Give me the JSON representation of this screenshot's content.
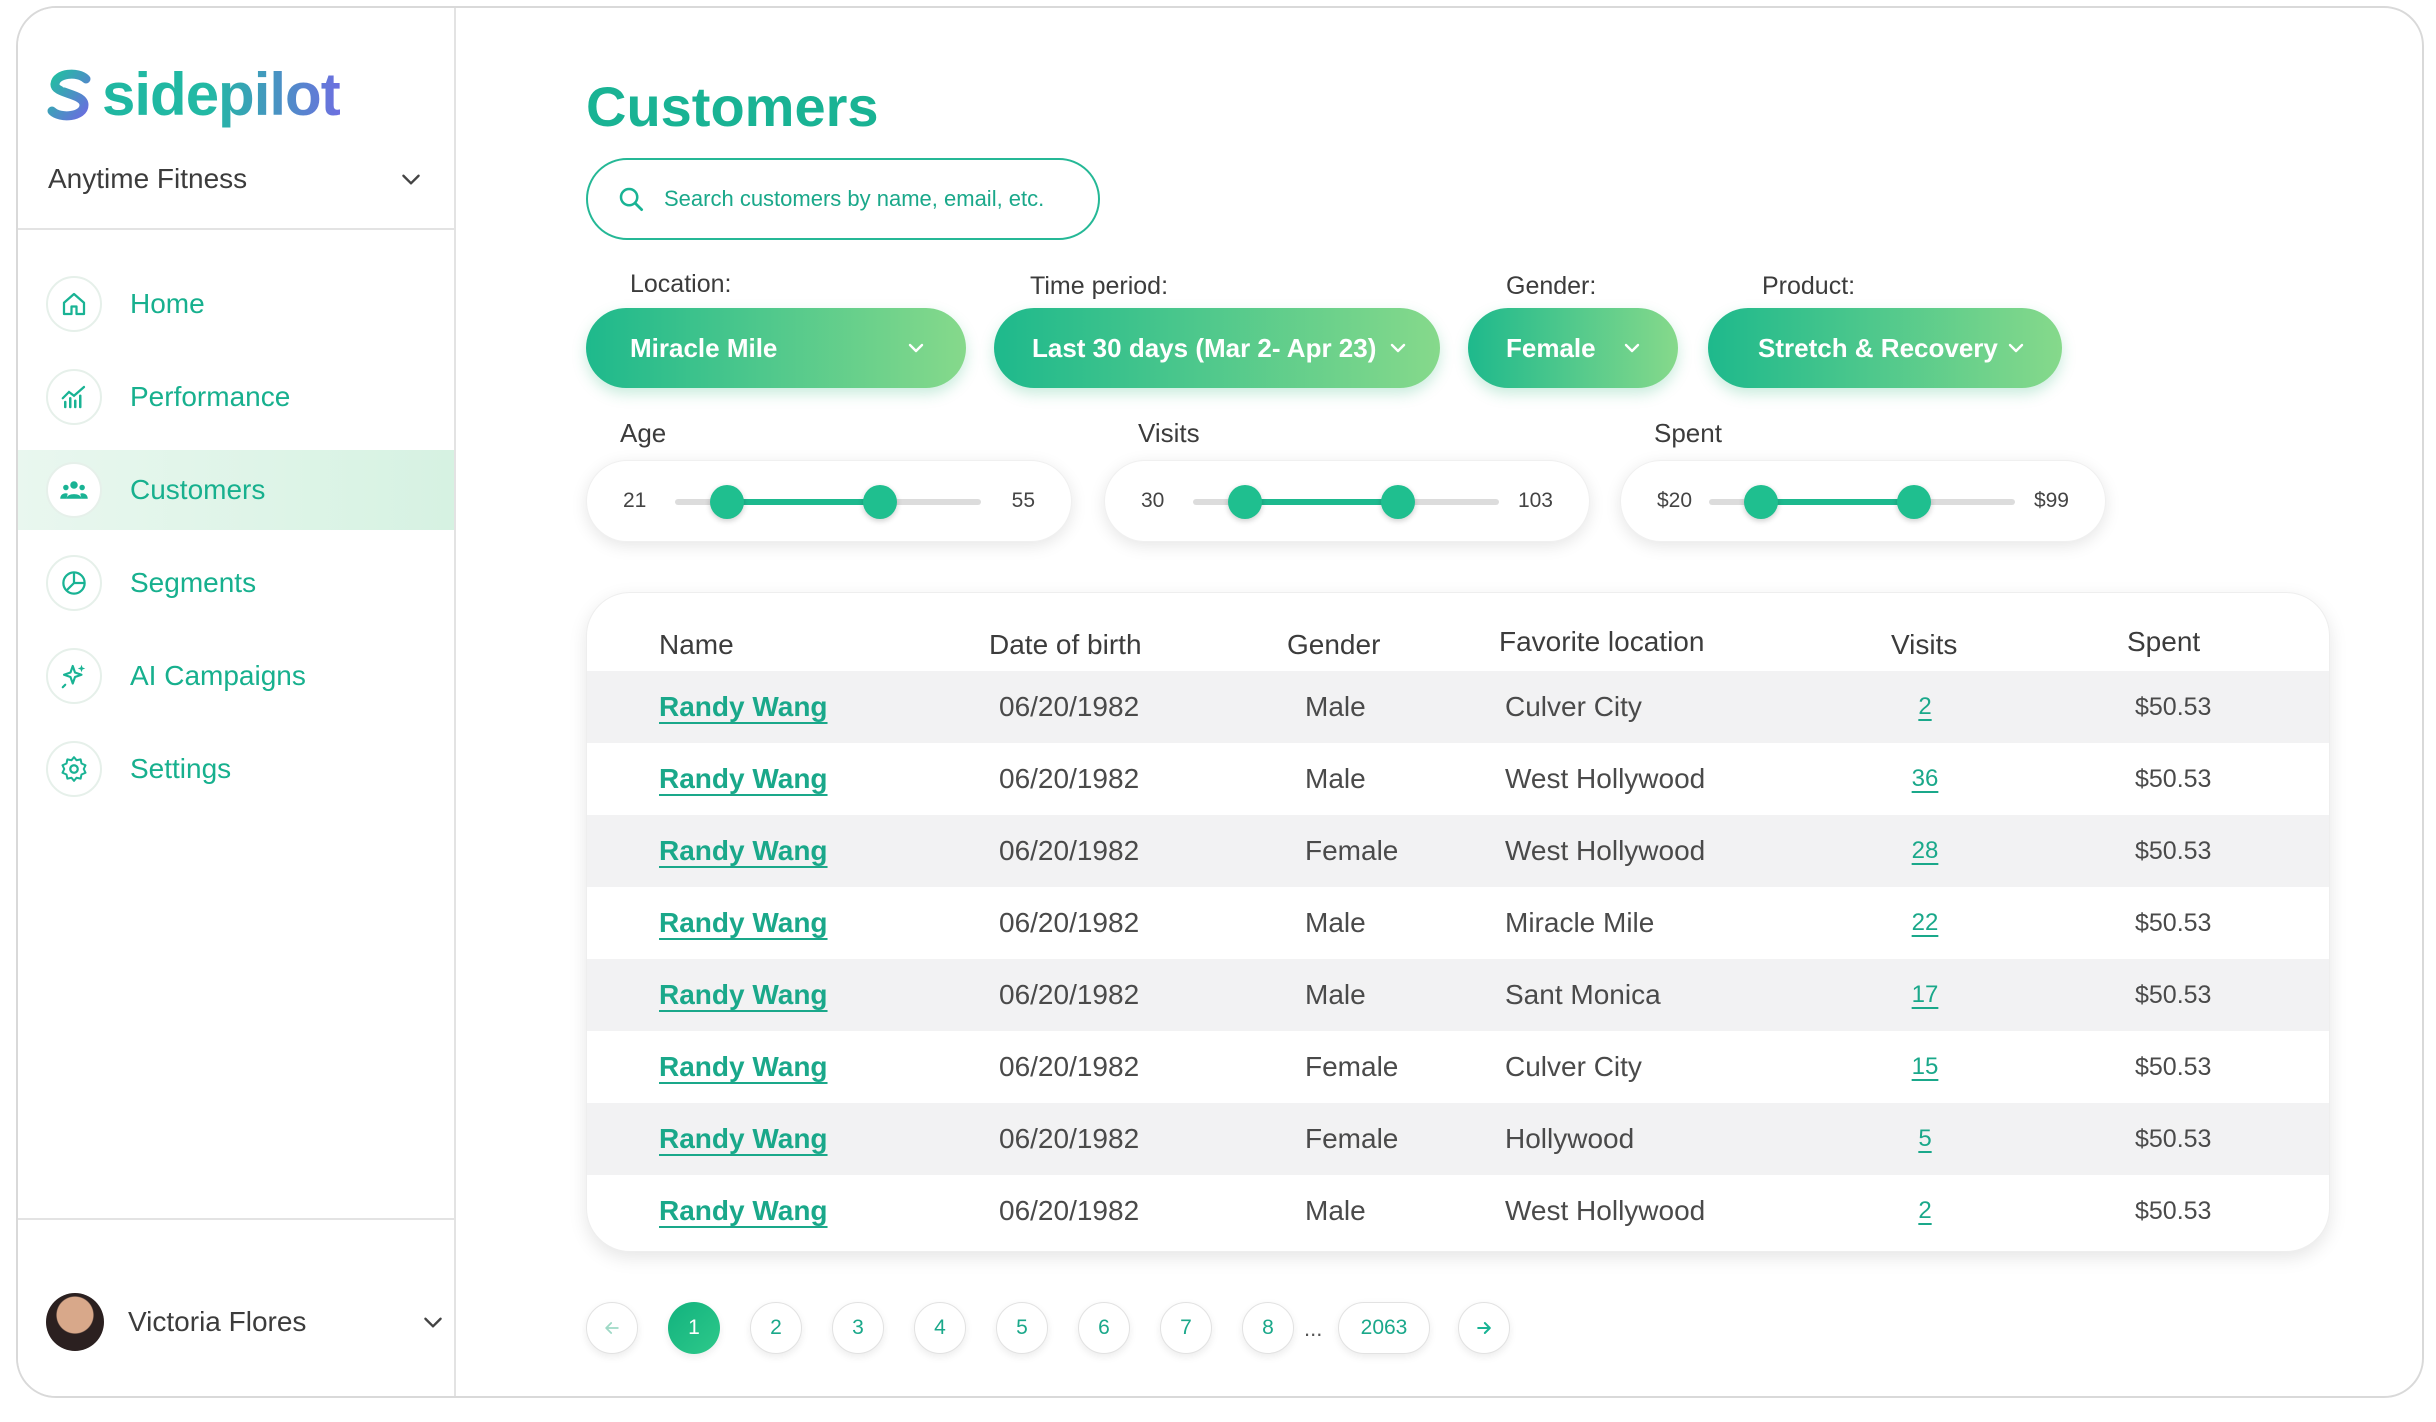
{
  "brand": {
    "name": "sidepilot"
  },
  "sidebar": {
    "org": "Anytime Fitness",
    "items": [
      {
        "label": "Home",
        "icon": "home-icon"
      },
      {
        "label": "Performance",
        "icon": "chart-icon"
      },
      {
        "label": "Customers",
        "icon": "users-icon",
        "active": true
      },
      {
        "label": "Segments",
        "icon": "pie-icon"
      },
      {
        "label": "AI Campaigns",
        "icon": "sparkle-icon"
      },
      {
        "label": "Settings",
        "icon": "gear-icon"
      }
    ],
    "user": {
      "name": "Victoria Flores"
    }
  },
  "page": {
    "title": "Customers"
  },
  "search": {
    "placeholder": "Search customers by name, email, etc."
  },
  "filters": {
    "location": {
      "label": "Location:",
      "value": "Miracle Mile"
    },
    "time_period": {
      "label": "Time period:",
      "value": "Last 30 days (Mar 2- Apr 23)"
    },
    "gender": {
      "label": "Gender:",
      "value": "Female"
    },
    "product": {
      "label": "Product:",
      "value": "Stretch & Recovery"
    }
  },
  "ranges": {
    "age": {
      "label": "Age",
      "min": "21",
      "max": "55",
      "low_pct": 17,
      "high_pct": 67
    },
    "visits": {
      "label": "Visits",
      "min": "30",
      "max": "103",
      "low_pct": 17,
      "high_pct": 67
    },
    "spent": {
      "label": "Spent",
      "min": "$20",
      "max": "$99",
      "low_pct": 17,
      "high_pct": 67
    }
  },
  "table": {
    "headers": {
      "name": "Name",
      "dob": "Date of birth",
      "gender": "Gender",
      "location": "Favorite location",
      "visits": "Visits",
      "spent": "Spent"
    },
    "rows": [
      {
        "name": "Randy Wang",
        "dob": "06/20/1982",
        "gender": "Male",
        "location": "Culver City",
        "visits": "2",
        "spent": "$50.53"
      },
      {
        "name": "Randy Wang",
        "dob": "06/20/1982",
        "gender": "Male",
        "location": "West Hollywood",
        "visits": "36",
        "spent": "$50.53"
      },
      {
        "name": "Randy Wang",
        "dob": "06/20/1982",
        "gender": "Female",
        "location": "West Hollywood",
        "visits": "28",
        "spent": "$50.53"
      },
      {
        "name": "Randy Wang",
        "dob": "06/20/1982",
        "gender": "Male",
        "location": "Miracle Mile",
        "visits": "22",
        "spent": "$50.53"
      },
      {
        "name": "Randy Wang",
        "dob": "06/20/1982",
        "gender": "Male",
        "location": "Sant Monica",
        "visits": "17",
        "spent": "$50.53"
      },
      {
        "name": "Randy Wang",
        "dob": "06/20/1982",
        "gender": "Female",
        "location": "Culver City",
        "visits": "15",
        "spent": "$50.53"
      },
      {
        "name": "Randy Wang",
        "dob": "06/20/1982",
        "gender": "Female",
        "location": "Hollywood",
        "visits": "5",
        "spent": "$50.53"
      },
      {
        "name": "Randy Wang",
        "dob": "06/20/1982",
        "gender": "Male",
        "location": "West Hollywood",
        "visits": "2",
        "spent": "$50.53"
      }
    ]
  },
  "pagination": {
    "pages": [
      "1",
      "2",
      "3",
      "4",
      "5",
      "6",
      "7",
      "8"
    ],
    "current": "1",
    "ellipsis": "...",
    "last": "2063"
  },
  "colors": {
    "accent": "#19b394",
    "accent_light": "#86d98b",
    "row_shade": "#f2f2f3"
  }
}
